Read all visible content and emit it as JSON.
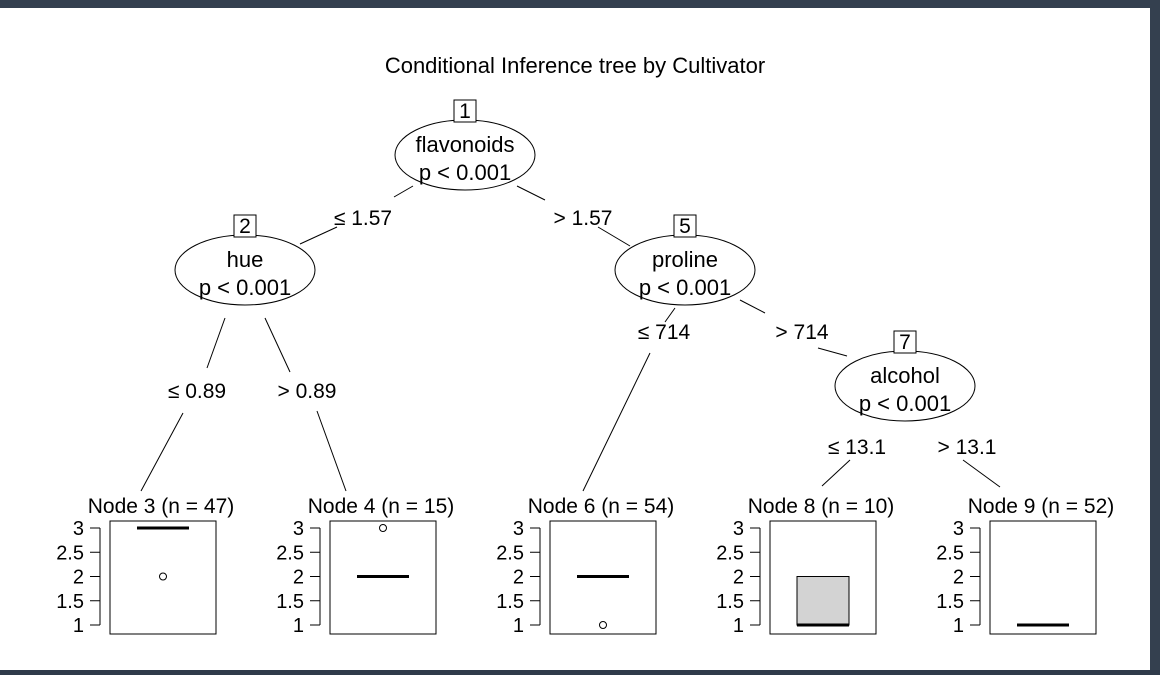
{
  "title": "Conditional Inference tree by Cultivator",
  "inner_nodes": [
    {
      "id": "1",
      "variable": "flavonoids",
      "pvalue": "p < 0.001"
    },
    {
      "id": "2",
      "variable": "hue",
      "pvalue": "p < 0.001"
    },
    {
      "id": "5",
      "variable": "proline",
      "pvalue": "p < 0.001"
    },
    {
      "id": "7",
      "variable": "alcohol",
      "pvalue": "p < 0.001"
    }
  ],
  "edges": [
    {
      "from": "1",
      "to": "2",
      "label": "≤ 1.57"
    },
    {
      "from": "1",
      "to": "5",
      "label": "> 1.57"
    },
    {
      "from": "2",
      "to": "3",
      "label": "≤ 0.89"
    },
    {
      "from": "2",
      "to": "4",
      "label": "> 0.89"
    },
    {
      "from": "5",
      "to": "6",
      "label": "≤ 714"
    },
    {
      "from": "5",
      "to": "7",
      "label": "> 714"
    },
    {
      "from": "7",
      "to": "8",
      "label": "≤ 13.1"
    },
    {
      "from": "7",
      "to": "9",
      "label": "> 13.1"
    }
  ],
  "terminal_nodes": [
    {
      "id": "3",
      "label": "Node 3 (n = 47)",
      "median": 3,
      "q1": 3,
      "q3": 3,
      "outliers": [
        2
      ]
    },
    {
      "id": "4",
      "label": "Node 4 (n = 15)",
      "median": 2,
      "q1": 2,
      "q3": 2,
      "outliers": [
        3
      ]
    },
    {
      "id": "6",
      "label": "Node 6 (n = 54)",
      "median": 2,
      "q1": 2,
      "q3": 2,
      "outliers": [
        1
      ]
    },
    {
      "id": "8",
      "label": "Node 8 (n = 10)",
      "median": 1,
      "q1": 1,
      "q3": 2,
      "outliers": []
    },
    {
      "id": "9",
      "label": "Node 9 (n = 52)",
      "median": 1,
      "q1": 1,
      "q3": 1,
      "outliers": []
    }
  ],
  "y_axis": {
    "ticks": [
      "3",
      "2.5",
      "2",
      "1.5",
      "1"
    ],
    "range": [
      1,
      3
    ]
  },
  "colors": {
    "box_fill": "#d3d3d3",
    "line": "#000000",
    "frame": "#34404f"
  }
}
